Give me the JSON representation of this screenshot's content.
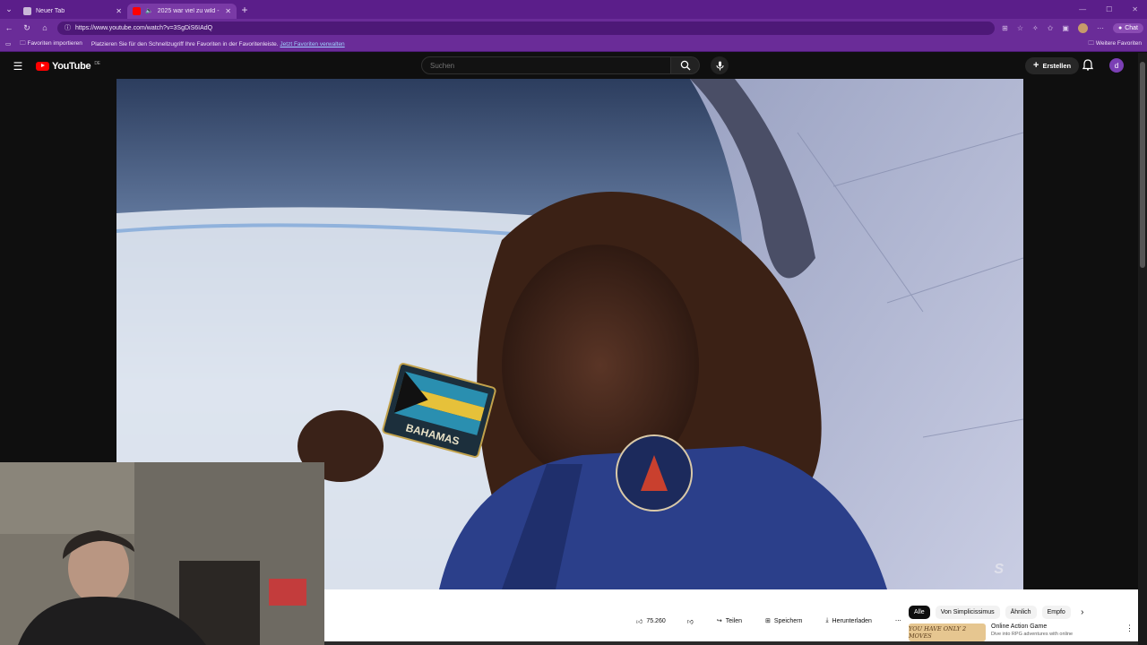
{
  "browser": {
    "tabs": [
      {
        "title": "Neuer Tab",
        "active": false
      },
      {
        "title": "2025 war viel zu wild - YouTube",
        "active": true
      }
    ],
    "url": "https://www.youtube.com/watch?v=3SgDiS6IAdQ",
    "chat_label": "Chat",
    "favorites_bar": {
      "import_label": "Favoriten importieren",
      "message": "Platzieren Sie für den Schnellzugriff Ihre Favoriten in der Favoritenleiste.",
      "manage_link": "Jetzt Favoriten verwalten",
      "more_label": "Weitere Favoriten"
    }
  },
  "youtube": {
    "logo_text": "YouTube",
    "region": "DE",
    "search_placeholder": "Suchen",
    "create_label": "Erstellen",
    "avatar_letter": "d"
  },
  "video": {
    "patch_text": "BAHAMAS",
    "watermark": "S"
  },
  "actions": {
    "like_count": "75.260",
    "share_label": "Teilen",
    "save_label": "Speichern",
    "download_label": "Herunterladen"
  },
  "chips": [
    "Alle",
    "Von Simplicissimus",
    "Ähnlich",
    "Empfo"
  ],
  "ad": {
    "thumb_text": "YOU HAVE ONLY 2 MOVES",
    "title": "Online Action Game",
    "subtitle": "Dive into RPG adventures with online"
  },
  "colors": {
    "browser_frame": "#5b1e8a",
    "yt_red": "#ff0000",
    "yt_bg": "#0f0f0f"
  }
}
